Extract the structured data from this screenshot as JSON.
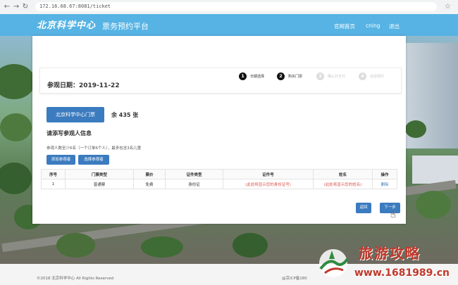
{
  "browser": {
    "url": "172.16.68.67:8081/ticket"
  },
  "header": {
    "logo": "北京科学中心",
    "title": "票务预约平台",
    "nav": [
      "官网首页",
      "cning",
      "退出"
    ]
  },
  "date": {
    "label": "参观日期：",
    "value": "2019-11-22"
  },
  "steps": [
    {
      "num": "1",
      "label": "日期选择",
      "active": true
    },
    {
      "num": "2",
      "label": "购买门票",
      "active": true
    },
    {
      "num": "3",
      "label": "确认并支付",
      "active": false
    },
    {
      "num": "4",
      "label": "完成预约",
      "active": false
    }
  ],
  "ticket": {
    "button": "北京科学中心门票",
    "remaining": "余 435 张"
  },
  "visitor_section": {
    "title": "请添写参观人信息",
    "notice": "参观人数至少6名（一个订单6个人），最多包含3名儿童",
    "add_buttons": [
      "添加参观者",
      "选择参观者"
    ]
  },
  "table": {
    "headers": [
      "序号",
      "门票类型",
      "票价",
      "证件类型",
      "证件号",
      "姓名",
      "操作"
    ],
    "rows": [
      [
        "1",
        "普通票",
        "免费",
        "身份证",
        "(此处将显示您的身份证号)",
        "(此处将显示您的姓名)",
        "删除"
      ]
    ]
  },
  "actions": {
    "back": "返回",
    "next": "下一步"
  },
  "footer": {
    "copyright": "©2018 北京科学中心 All Rights Reserved",
    "icp": "@京ICP备180"
  },
  "watermark": {
    "title": "旅游攻略",
    "url": "www.1681989.cn"
  },
  "colors": {
    "header": "#56b3e4",
    "primary_button": "#3b7bbf",
    "warning_text": "#d9534f",
    "watermark": "#c0392b"
  }
}
